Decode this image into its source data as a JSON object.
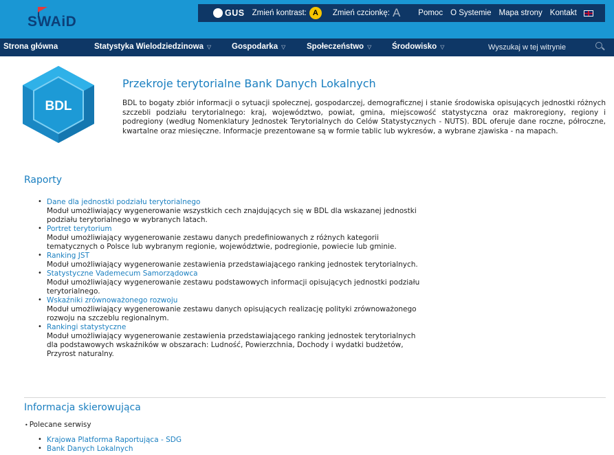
{
  "header": {
    "logo": "SWAiD",
    "topbar": {
      "gus": "GUS",
      "contrast_label": "Zmień kontrast:",
      "contrast_badge": "A",
      "font_label": "Zmień czcionkę:",
      "font_glyph": "A",
      "help": "Pomoc",
      "about": "O Systemie",
      "sitemap": "Mapa strony",
      "contact": "Kontakt"
    }
  },
  "nav": {
    "items": [
      "Strona główna",
      "Statystyka Wielodziedzinowa",
      "Gospodarka",
      "Społeczeństwo",
      "Środowisko"
    ],
    "search_placeholder": "Wyszukaj w tej witrynie"
  },
  "intro": {
    "logo_text": "BDL",
    "title": "Przekroje terytorialne Bank Danych Lokalnych",
    "text": "BDL to bogaty zbiór informacji o sytuacji społecznej, gospodarczej, demograficznej i stanie środowiska opisujących jednostki różnych szczebli podziału terytorialnego: kraj, województwo, powiat, gmina, miejscowość statystyczna oraz makroregiony, regiony i podregiony (według Nomenklatury Jednostek Terytorialnych do Celów Statystycznych - NUTS). BDL oferuje dane roczne, półroczne, kwartalne oraz miesięczne. Informacje prezentowane są w formie tablic lub wykresów, a wybrane zjawiska - na mapach."
  },
  "reports": {
    "title": "Raporty",
    "items": [
      {
        "link": "Dane dla jednostki podziału terytorialnego",
        "desc": "Moduł umożliwiający wygenerowanie wszystkich cech znajdujących się w BDL dla wskazanej jednostki podziału terytorialnego w wybranych latach."
      },
      {
        "link": "Portret terytorium",
        "desc": "Moduł umożliwiający wygenerowanie zestawu danych predefiniowanych z różnych kategorii tematycznych o Polsce lub wybranym regionie, województwie, podregionie, powiecie lub gminie."
      },
      {
        "link": "Ranking JST",
        "desc": "Moduł umożliwiający wygenerowanie zestawienia przedstawiającego ranking jednostek terytorialnych."
      },
      {
        "link": "Statystyczne Vademecum Samorządowca",
        "desc": "Moduł umożliwiający wygenerowanie zestawu podstawowych informacji opisujących jednostki podziału terytorialnego."
      },
      {
        "link": "Wskaźniki zrównoważonego rozwoju",
        "desc": "Moduł umożliwiający wygenerowanie zestawu danych opisujących realizację polityki zrównoważonego rozwoju na szczeblu regionalnym."
      },
      {
        "link": "Rankingi statystyczne",
        "desc": "Moduł umożliwiający wygenerowanie zestawienia przedstawiającego ranking jednostek terytorialnych dla podstawowych wskaźników w obszarach: Ludność, Powierzchnia, Dochody i wydatki budżetów, Przyrost naturalny."
      }
    ]
  },
  "referral": {
    "title": "Informacja skierowująca",
    "subhead": "Polecane serwisy",
    "links": [
      "Krajowa Platforma Raportująca - SDG",
      "Bank Danych Lokalnych"
    ]
  },
  "colors": {
    "header_bg": "#1a97d4",
    "bar_bg": "#0e3766",
    "link": "#1a7fc0",
    "contrast_badge": "#f5c400"
  }
}
